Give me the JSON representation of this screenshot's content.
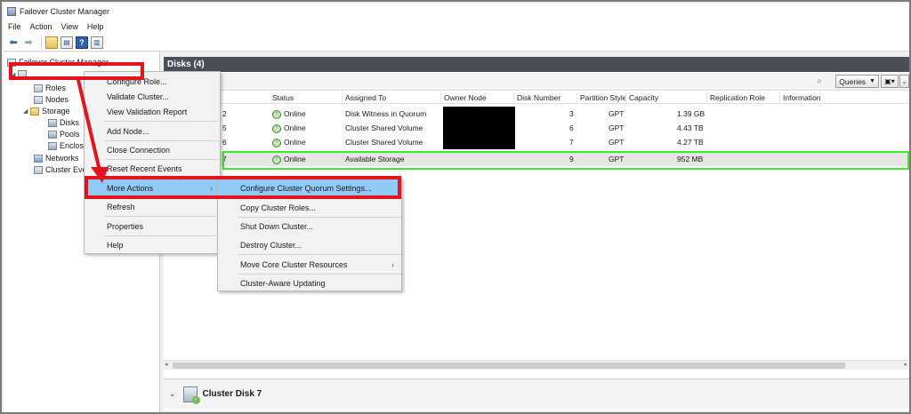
{
  "window": {
    "title": "Failover Cluster Manager"
  },
  "menu_bar": [
    "File",
    "Action",
    "View",
    "Help"
  ],
  "toolbar": {
    "icons": [
      "back-arrow-icon",
      "forward-arrow-icon",
      "folder-up-icon",
      "console-tree-icon",
      "help-icon",
      "action-pane-icon"
    ]
  },
  "tree": {
    "root_label": "Failover Cluster Manager",
    "items": {
      "roles": "Roles",
      "nodes": "Nodes",
      "storage": "Storage",
      "disks": "Disks",
      "pools": "Pools",
      "enclosures": "Enclosu",
      "networks": "Networks",
      "cluster_events": "Cluster Eve"
    }
  },
  "main": {
    "header": "Disks (4)",
    "queries_label": "Queries",
    "columns": [
      "Status",
      "Assigned To",
      "Owner Node",
      "Disk Number",
      "Partition Style",
      "Capacity",
      "Replication Role",
      "Information"
    ],
    "rows": [
      {
        "name": "2",
        "status": "Online",
        "assigned_to": "Disk Witness in Quorum",
        "owner": "",
        "disk_number": "3",
        "partition": "GPT",
        "capacity": "1.39 GB"
      },
      {
        "name": "5",
        "status": "Online",
        "assigned_to": "Cluster Shared Volume",
        "owner": "",
        "disk_number": "6",
        "partition": "GPT",
        "capacity": "4.43 TB"
      },
      {
        "name": "6",
        "status": "Online",
        "assigned_to": "Cluster Shared Volume",
        "owner": "",
        "disk_number": "7",
        "partition": "GPT",
        "capacity": "4.27 TB"
      },
      {
        "name": "7",
        "status": "Online",
        "assigned_to": "Available Storage",
        "owner": "",
        "disk_number": "9",
        "partition": "GPT",
        "capacity": "952 MB"
      }
    ],
    "detail_title": "Cluster Disk 7"
  },
  "context_menu": {
    "items": {
      "configure_role": "Configure Role...",
      "validate_cluster": "Validate Cluster...",
      "view_validation_report": "View Validation Report",
      "add_node": "Add Node...",
      "close_connection": "Close Connection",
      "reset_recent_events": "Reset Recent Events",
      "more_actions": "More Actions",
      "refresh": "Refresh",
      "properties": "Properties",
      "help": "Help"
    }
  },
  "submenu": {
    "items": {
      "configure_quorum": "Configure Cluster Quorum Settings...",
      "copy_cluster_roles": "Copy Cluster Roles...",
      "shut_down_cluster": "Shut Down Cluster...",
      "destroy_cluster": "Destroy Cluster...",
      "move_core_resources": "Move Core Cluster Resources",
      "cluster_aware_updating": "Cluster-Aware Updating"
    }
  },
  "colors": {
    "annotation_red": "#e4141c",
    "annotation_green": "#3ee82f",
    "header_bg": "#4a4f57",
    "menu_highlight": "#91c9f7"
  }
}
